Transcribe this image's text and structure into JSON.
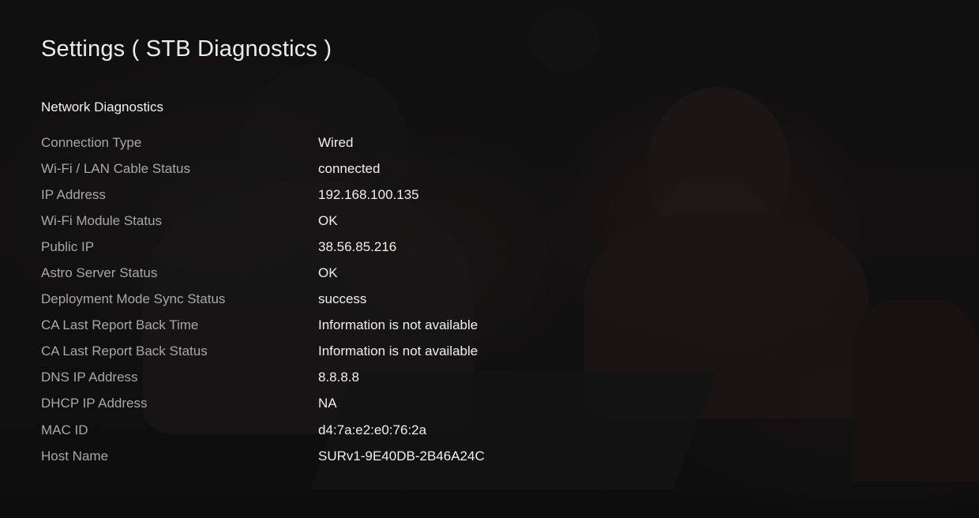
{
  "page": {
    "title": "Settings ( STB Diagnostics )"
  },
  "section": {
    "title": "Network Diagnostics"
  },
  "rows": [
    {
      "label": "Connection Type",
      "value": "Wired"
    },
    {
      "label": "Wi-Fi / LAN Cable Status",
      "value": "connected"
    },
    {
      "label": "IP Address",
      "value": "192.168.100.135"
    },
    {
      "label": "Wi-Fi Module Status",
      "value": "OK"
    },
    {
      "label": "Public IP",
      "value": "38.56.85.216"
    },
    {
      "label": "Astro Server Status",
      "value": "OK"
    },
    {
      "label": "Deployment Mode Sync Status",
      "value": "success"
    },
    {
      "label": "CA Last Report Back Time",
      "value": "Information is not available"
    },
    {
      "label": "CA Last Report Back Status",
      "value": "Information is not available"
    },
    {
      "label": "DNS IP Address",
      "value": "8.8.8.8"
    },
    {
      "label": "DHCP IP Address",
      "value": "NA"
    },
    {
      "label": "MAC ID",
      "value": "d4:7a:e2:e0:76:2a"
    },
    {
      "label": "Host Name",
      "value": "SURv1-9E40DB-2B46A24C"
    }
  ],
  "colors": {
    "background": "#141414",
    "title": "#ececec",
    "label": "#a8a8a8",
    "value": "#f0f0f0"
  }
}
